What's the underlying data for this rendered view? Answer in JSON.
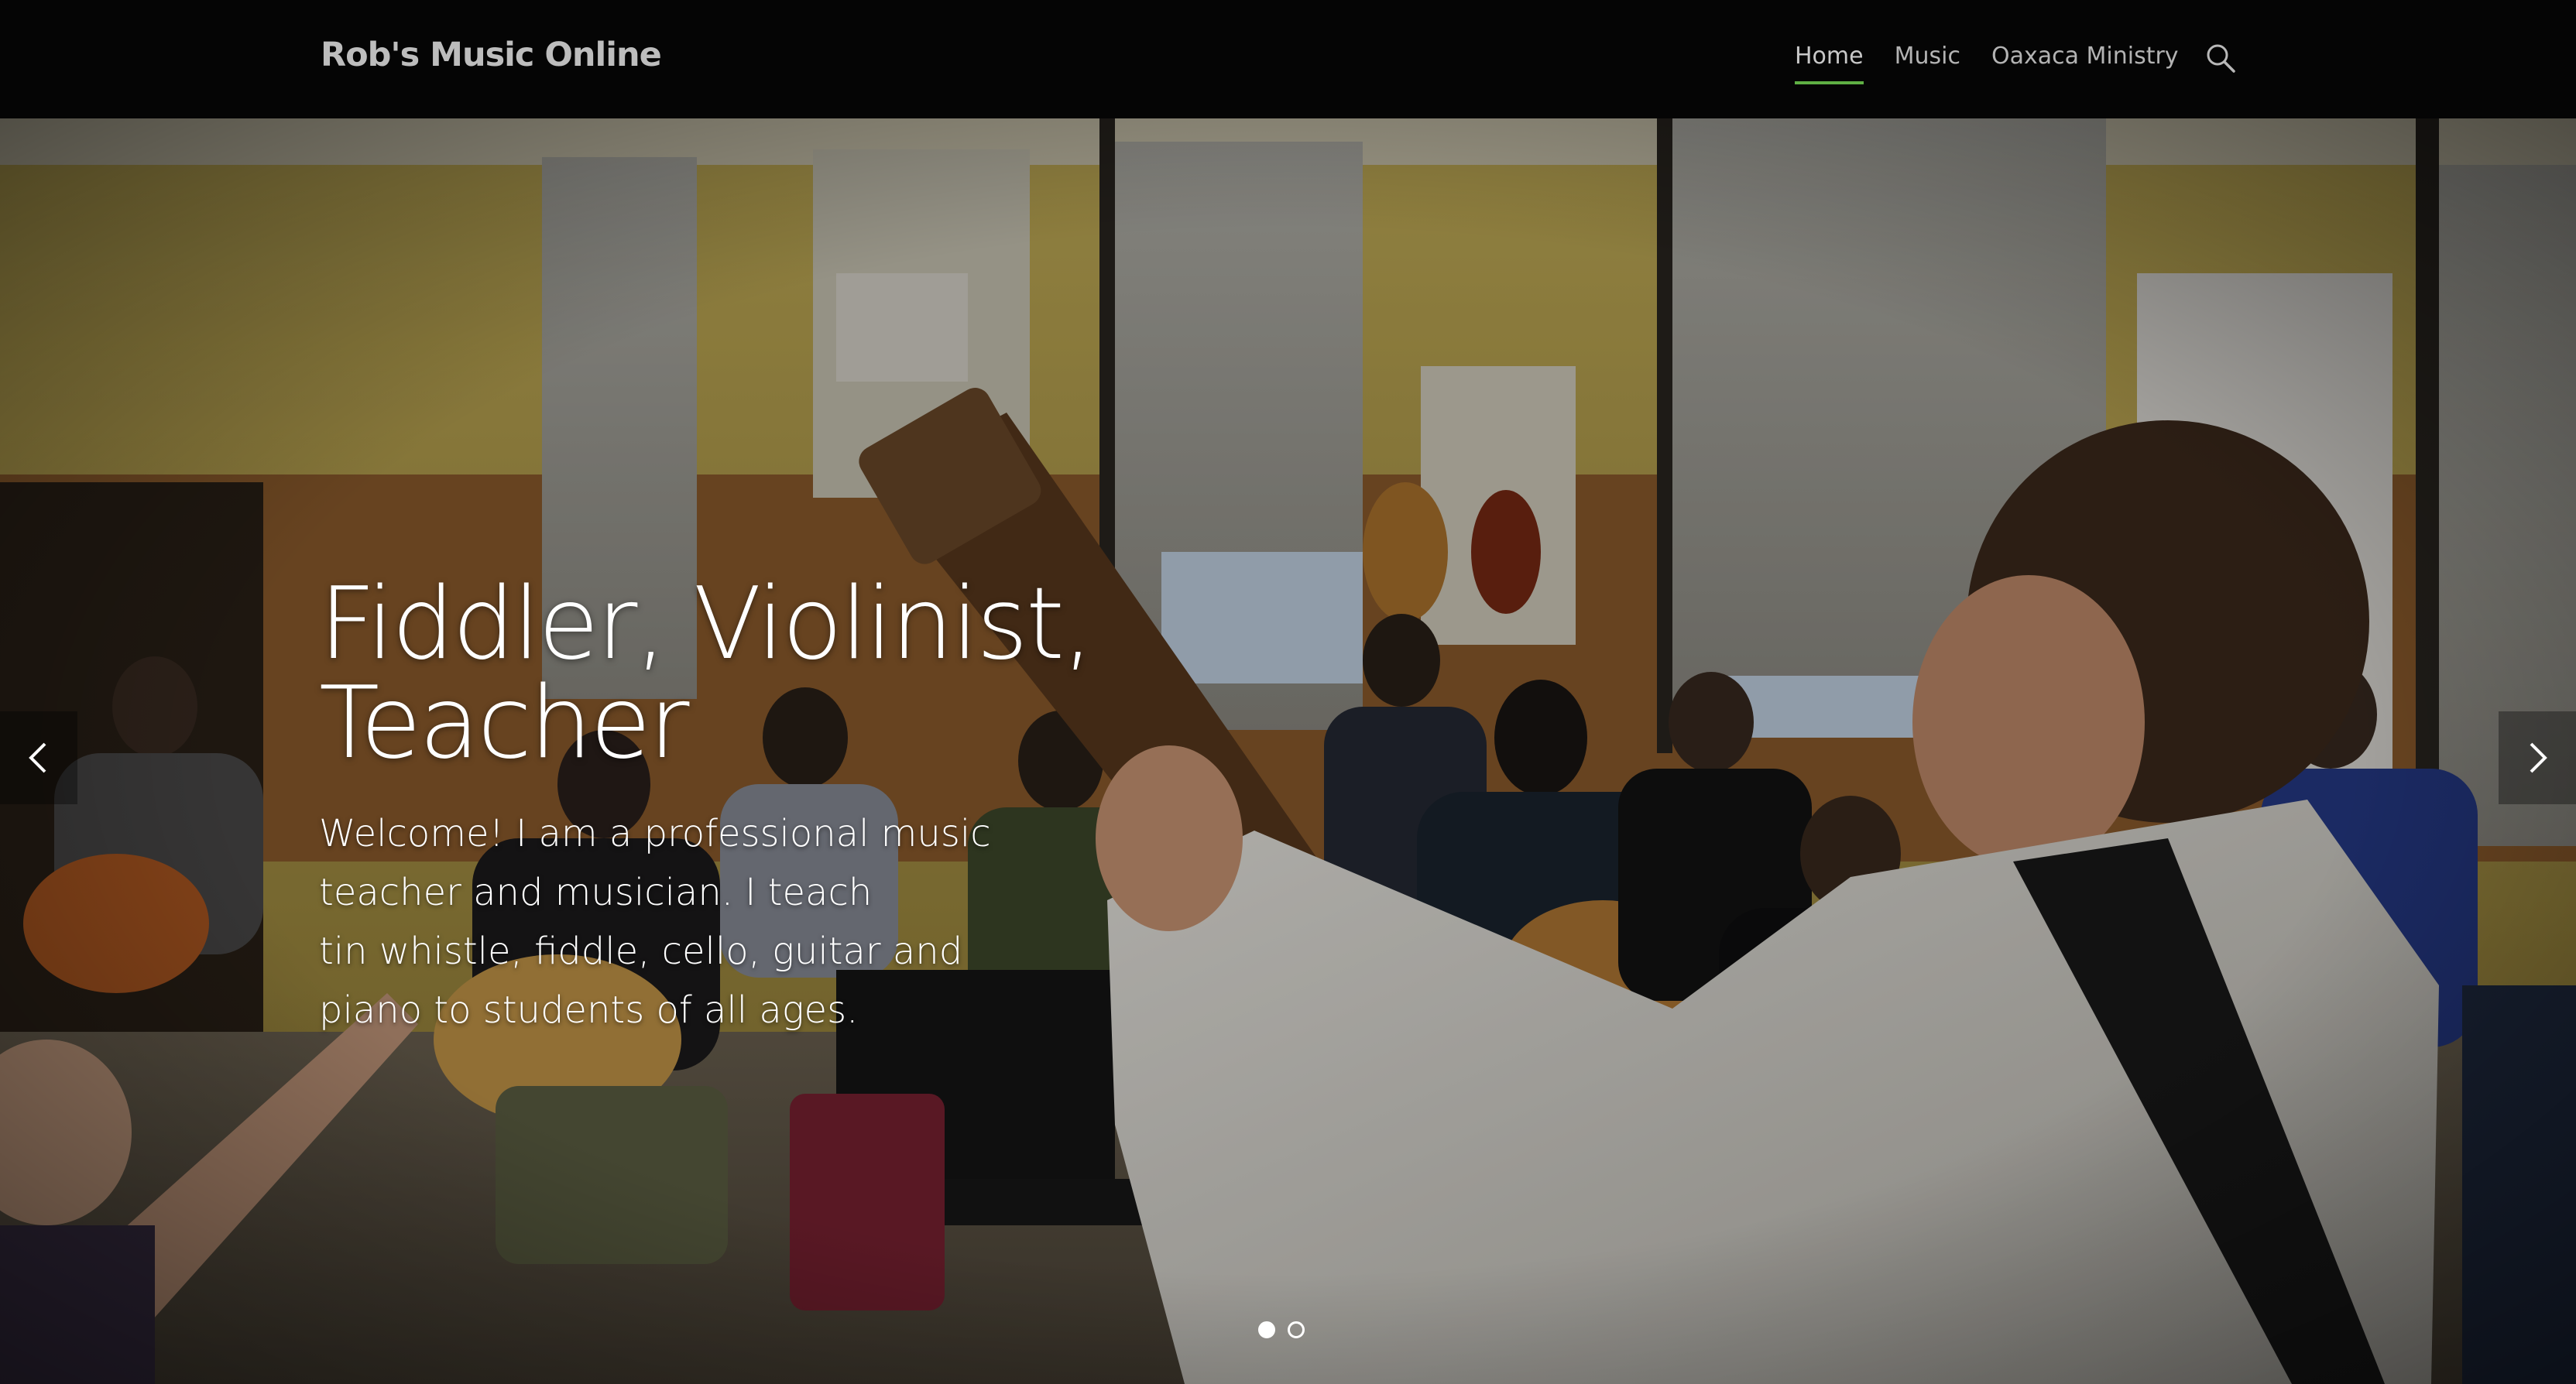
{
  "site": {
    "brand": "Rob's Music Online"
  },
  "nav": {
    "items": [
      {
        "label": "Home",
        "active": true
      },
      {
        "label": "Music",
        "active": false
      },
      {
        "label": "Oaxaca Ministry",
        "active": false
      }
    ],
    "search_icon": "search-icon"
  },
  "hero": {
    "title": "Fiddler, Violinist, Teacher",
    "description_lines": [
      "Welcome!  I am a professional music",
      "teacher and musician. I teach",
      "tin whistle, fiddle, cello, guitar and",
      "piano to students of all ages."
    ],
    "prev_icon": "chevron-left-icon",
    "next_icon": "chevron-right-icon",
    "slides_total": 2,
    "slide_active": 1
  },
  "colors": {
    "header_bg": "#050505",
    "nav_active_underline": "#5fb044",
    "brand_text": "#bdbdbd"
  }
}
